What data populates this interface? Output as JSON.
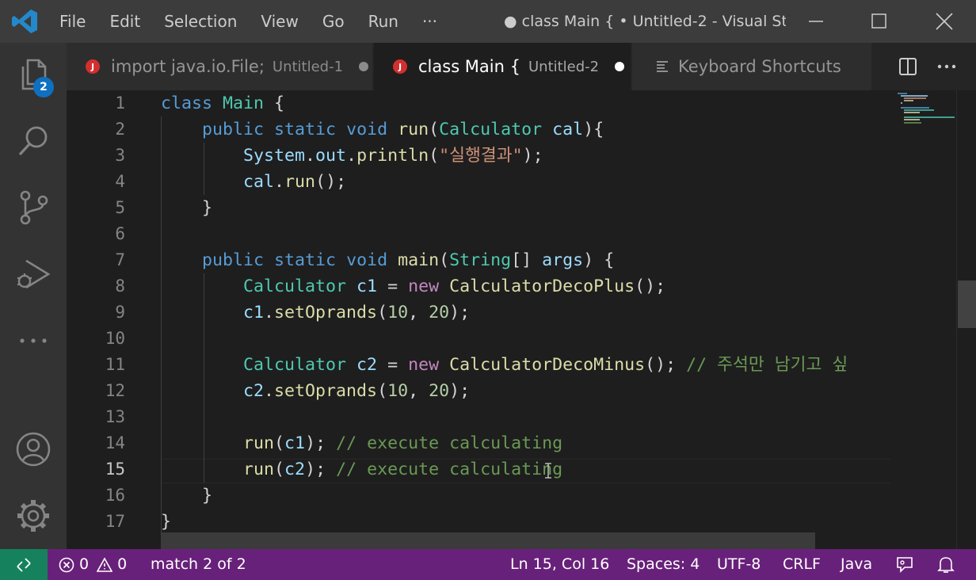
{
  "titlebar": {
    "menu": [
      "File",
      "Edit",
      "Selection",
      "View",
      "Go",
      "Run",
      "···"
    ],
    "window_title": "● class Main { • Untitled-2 - Visual St..."
  },
  "activitybar": {
    "explorer_badge": "2"
  },
  "tabs": [
    {
      "icon": "J",
      "label": "import java.io.File;",
      "description": "Untitled-1",
      "dirty": true,
      "active": false
    },
    {
      "icon": "J",
      "label": "class Main {",
      "description": "Untitled-2",
      "dirty": true,
      "active": true
    },
    {
      "label": "Keyboard Shortcuts",
      "active": false
    }
  ],
  "editor": {
    "language": "java",
    "current_line": 15,
    "line_numbers": [
      "1",
      "2",
      "3",
      "4",
      "5",
      "6",
      "7",
      "8",
      "9",
      "10",
      "11",
      "12",
      "13",
      "14",
      "15",
      "16",
      "17"
    ],
    "lines": [
      "class Main {",
      "    public static void run(Calculator cal){",
      "        System.out.println(\"실행결과\");",
      "        cal.run();",
      "    }",
      "",
      "    public static void main(String[] args) {",
      "        Calculator c1 = new CalculatorDecoPlus();",
      "        c1.setOprands(10, 20);",
      "",
      "        Calculator c2 = new CalculatorDecoMinus(); // 주석만 남기고 싶",
      "        c2.setOprands(10, 20);",
      "",
      "        run(c1); // execute calculating",
      "        run(c2); // execute calculating",
      "    }",
      "}"
    ]
  },
  "statusbar": {
    "errors": "0",
    "warnings": "0",
    "search": "match 2 of 2",
    "cursor": "Ln 15, Col 16",
    "indent": "Spaces: 4",
    "encoding": "UTF-8",
    "eol": "CRLF",
    "language": "Java"
  },
  "colors": {
    "titlebar": "#3c3c3c",
    "activitybar": "#333333",
    "editor": "#1e1e1e",
    "statusbar": "#68217a",
    "remote": "#16825d",
    "badge": "#0e70c0"
  }
}
